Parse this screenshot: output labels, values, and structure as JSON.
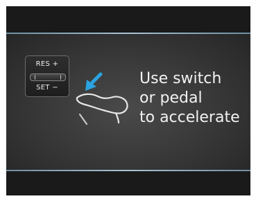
{
  "cruise_switch": {
    "resume_label": "RES +",
    "set_label": "SET −"
  },
  "message": {
    "lines": [
      "Use switch",
      "or pedal",
      "to accelerate"
    ]
  },
  "icons": {
    "pedal": "accelerator-pedal-icon",
    "arrow": "press-arrow-icon"
  },
  "colors": {
    "arrow": "#2aa3e0",
    "text": "#f2f2f2",
    "divider": "#a9c4d3"
  }
}
